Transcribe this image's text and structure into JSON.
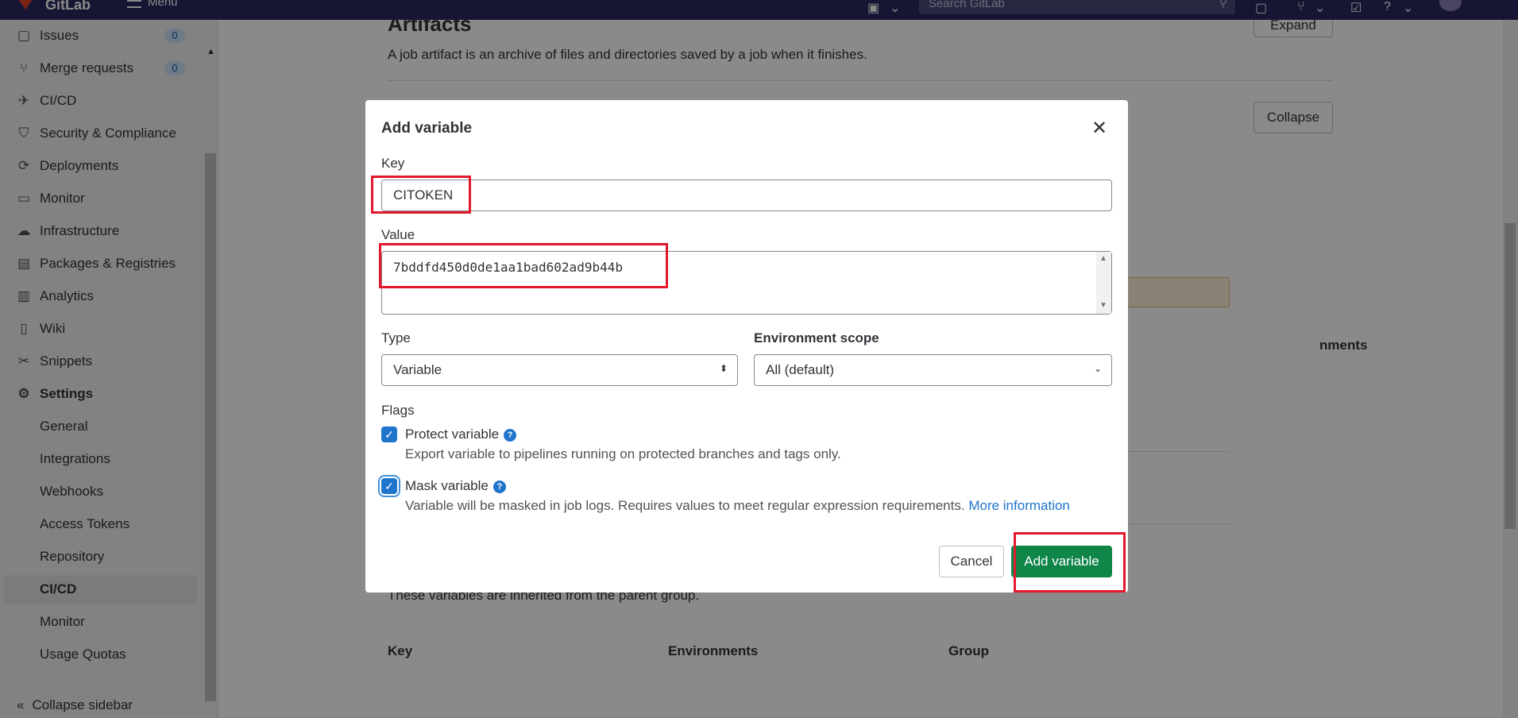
{
  "topbar": {
    "brand": "GitLab",
    "menu_label": "Menu",
    "search_placeholder": "Search GitLab"
  },
  "sidebar": {
    "items": [
      {
        "label": "Issues",
        "icon": "issues-icon",
        "badge": "0"
      },
      {
        "label": "Merge requests",
        "icon": "merge-request-icon",
        "badge": "0"
      },
      {
        "label": "CI/CD",
        "icon": "rocket-icon"
      },
      {
        "label": "Security & Compliance",
        "icon": "shield-icon"
      },
      {
        "label": "Deployments",
        "icon": "deployments-icon"
      },
      {
        "label": "Monitor",
        "icon": "monitor-icon"
      },
      {
        "label": "Infrastructure",
        "icon": "cloud-icon"
      },
      {
        "label": "Packages & Registries",
        "icon": "package-icon"
      },
      {
        "label": "Analytics",
        "icon": "chart-icon"
      },
      {
        "label": "Wiki",
        "icon": "book-icon"
      },
      {
        "label": "Snippets",
        "icon": "scissors-icon"
      },
      {
        "label": "Settings",
        "icon": "gear-icon"
      }
    ],
    "settings_subitems": [
      "General",
      "Integrations",
      "Webhooks",
      "Access Tokens",
      "Repository",
      "CI/CD",
      "Monitor",
      "Usage Quotas"
    ],
    "active_subitem": "CI/CD",
    "collapse_label": "Collapse sidebar"
  },
  "page": {
    "artifacts_title": "Artifacts",
    "artifacts_desc": "A job artifact is an archive of files and directories saved by a job when it finishes.",
    "expand_label": "Expand",
    "collapse_label": "Collapse",
    "environments_partial": "nments",
    "inherited_desc": "These variables are inherited from the parent group.",
    "table_headers": [
      "Key",
      "Environments",
      "Group"
    ]
  },
  "modal": {
    "title": "Add variable",
    "key_label": "Key",
    "key_value": "CITOKEN",
    "value_label": "Value",
    "value_value": "7bddfd450d0de1aa1bad602ad9b44b",
    "type_label": "Type",
    "type_value": "Variable",
    "env_label": "Environment scope",
    "env_value": "All (default)",
    "flags_label": "Flags",
    "protect_label": "Protect variable",
    "protect_desc": "Export variable to pipelines running on protected branches and tags only.",
    "protect_checked": true,
    "mask_label": "Mask variable",
    "mask_desc": "Variable will be masked in job logs. Requires values to meet regular expression requirements.",
    "more_info": "More information",
    "mask_checked": true,
    "cancel_label": "Cancel",
    "add_label": "Add variable"
  },
  "colors": {
    "accent": "#1f75cb",
    "primary_button": "#108548",
    "annotation": "#e3182d",
    "topbar": "#292961"
  }
}
